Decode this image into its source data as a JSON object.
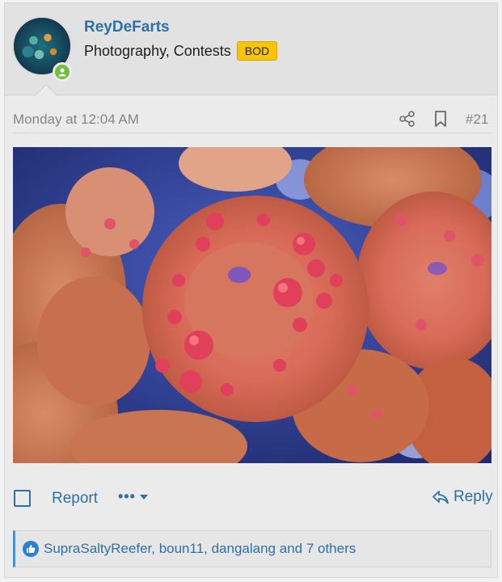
{
  "user": {
    "name": "ReyDeFarts",
    "title": "Photography, Contests",
    "badge": "BOD",
    "online_color": "#6fbf3a"
  },
  "post": {
    "date": "Monday at 12:04 AM",
    "number": "#21",
    "image_alt_icon": "coral-photo"
  },
  "actions": {
    "report_label": "Report",
    "more_label": "•••",
    "reply_label": "Reply"
  },
  "reactions": {
    "text": "SupraSaltyReefer, boun11, dangalang and 7 others",
    "icon": "like-icon"
  },
  "colors": {
    "link": "#2f6fa8",
    "badge_yellow": "#f7c600",
    "like_blue": "#2b7fd4"
  }
}
